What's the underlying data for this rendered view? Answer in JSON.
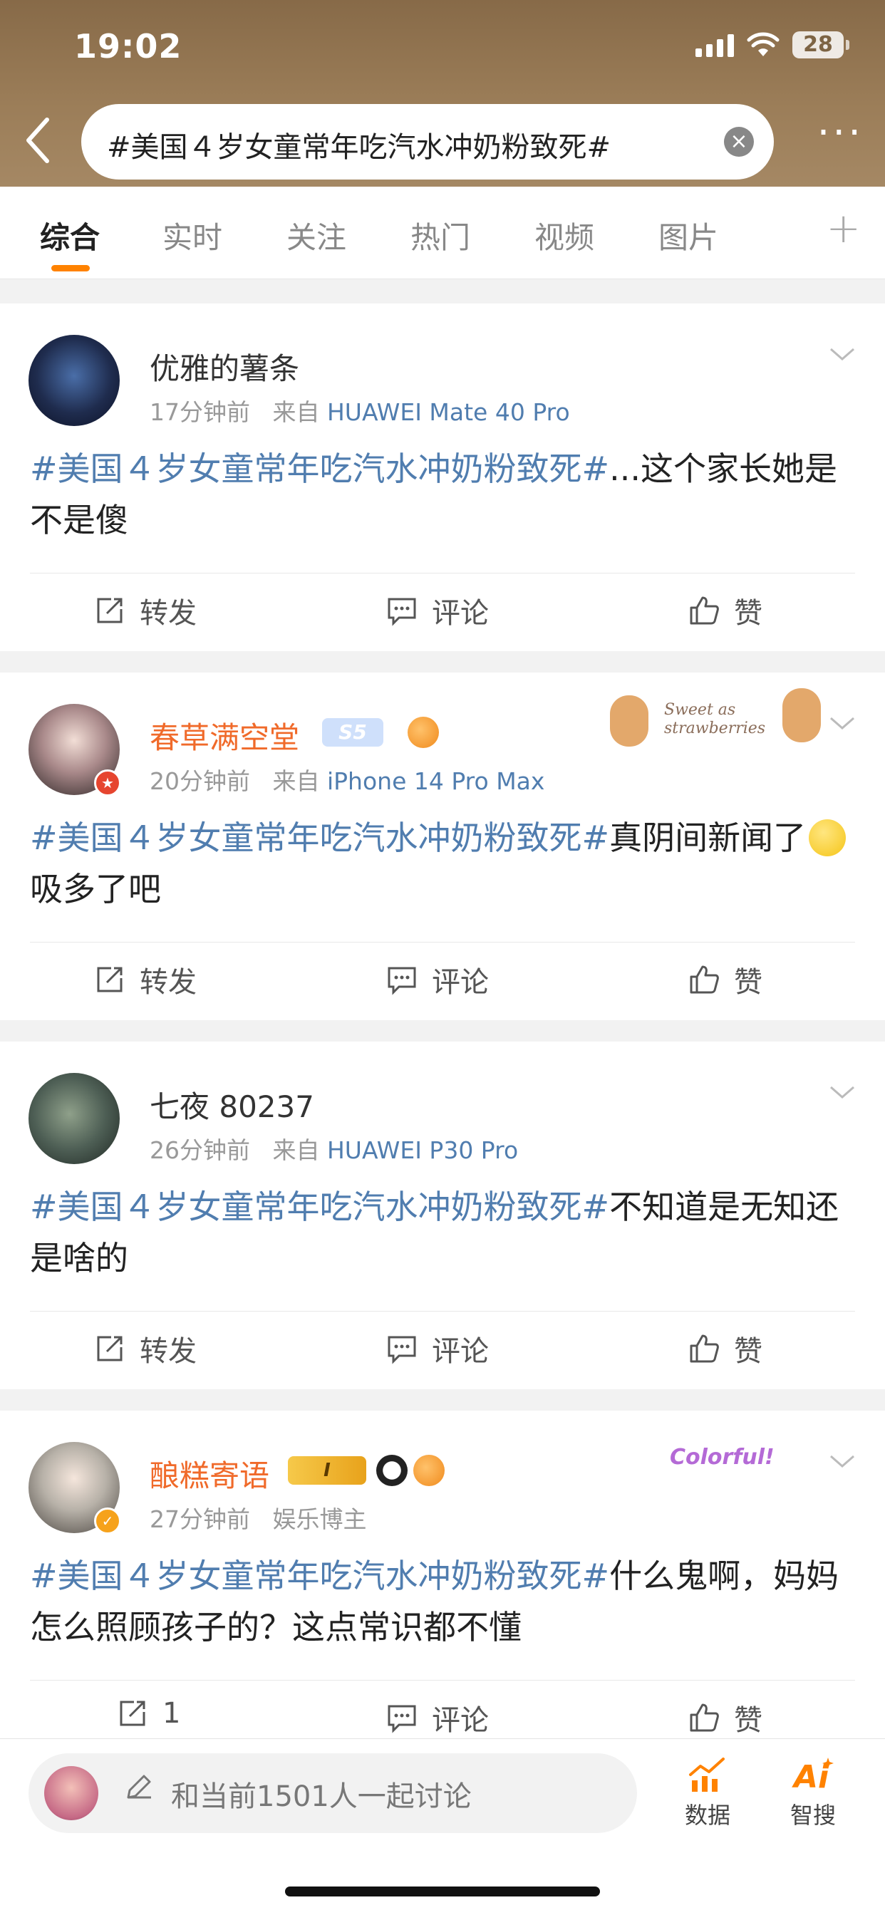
{
  "status_bar": {
    "time": "19:02",
    "battery": "28"
  },
  "search": {
    "query": "#美国４岁女童常年吃汽水冲奶粉致死#"
  },
  "tabs": [
    "综合",
    "实时",
    "关注",
    "热门",
    "视频",
    "图片"
  ],
  "posts": [
    {
      "username": "优雅的薯条",
      "time": "17分钟前",
      "source_prefix": "来自",
      "device": "HUAWEI Mate 40 Pro",
      "topic": "#美国４岁女童常年吃汽水冲奶粉致死#",
      "text": "...这个家长她是不是傻",
      "repost": "转发",
      "comment": "评论",
      "like": "赞"
    },
    {
      "username": "春草满空堂",
      "badge_text": "S5",
      "time": "20分钟前",
      "source_prefix": "来自",
      "device": "iPhone 14 Pro Max",
      "topic": "#美国４岁女童常年吃汽水冲奶粉致死#",
      "text_before_emoji": "真阴间新闻了",
      "text_after_emoji": "吸多了吧",
      "repost": "转发",
      "comment": "评论",
      "like": "赞",
      "decoration_text": "Sweet as strawberries"
    },
    {
      "username": "七夜 80237",
      "time": "26分钟前",
      "source_prefix": "来自",
      "device": "HUAWEI P30 Pro",
      "topic": "#美国４岁女童常年吃汽水冲奶粉致死#",
      "text": "不知道是无知还是啥的",
      "repost": "转发",
      "comment": "评论",
      "like": "赞"
    },
    {
      "username": "酿糕寄语",
      "badge_text": "I",
      "time": "27分钟前",
      "source": "娱乐博主",
      "topic": "#美国４岁女童常年吃汽水冲奶粉致死#",
      "text": "什么鬼啊，妈妈怎么照顾孩子的？这点常识都不懂",
      "repost": "1",
      "comment": "评论",
      "like": "赞",
      "decoration_text": "Colorful!"
    }
  ],
  "bottom_bar": {
    "discuss_placeholder": "和当前1501人一起讨论",
    "data_label": "数据",
    "ai_search_label": "智搜"
  },
  "colors": {
    "header": "#9b7d58",
    "topic_link": "#507daf",
    "accent": "#ff8200",
    "vip_name": "#f06a2a"
  }
}
